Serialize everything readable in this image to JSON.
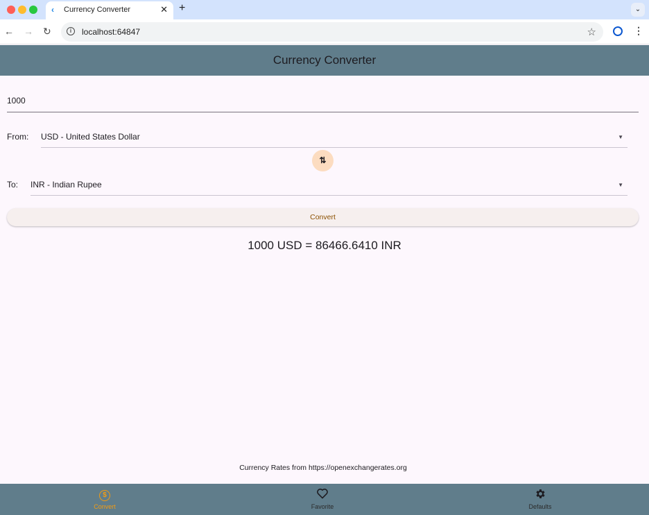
{
  "browser": {
    "tab_title": "Currency Converter",
    "tab_close": "✕",
    "new_tab": "+",
    "tab_menu": "⌄",
    "url": "localhost:64847"
  },
  "app": {
    "title": "Currency Converter"
  },
  "form": {
    "amount": "1000",
    "from_label": "From:",
    "from_value": "USD - United States Dollar",
    "to_label": "To:",
    "to_value": "INR - Indian Rupee",
    "convert_label": "Convert"
  },
  "result": {
    "text": "1000 USD = 86466.6410 INR"
  },
  "footer": {
    "note": "Currency Rates from https://openexchangerates.org"
  },
  "bottom_nav": {
    "items": [
      {
        "label": "Convert",
        "icon": "dollar-circle-icon",
        "active": true
      },
      {
        "label": "Favorite",
        "icon": "heart-icon",
        "active": false
      },
      {
        "label": "Defaults",
        "icon": "gear-icon",
        "active": false
      }
    ]
  },
  "colors": {
    "appbar": "#607d8b",
    "accent": "#f39c12",
    "swap_button": "#fcdcc0"
  }
}
